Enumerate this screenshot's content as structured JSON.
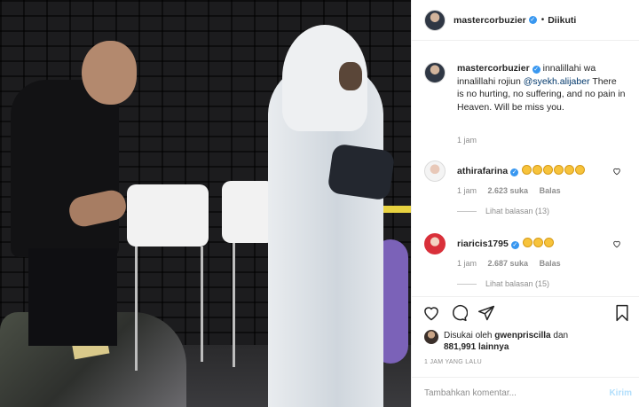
{
  "post": {
    "author": "mastercorbuzier",
    "follow_status": "Diikuti",
    "dot": "•",
    "caption": {
      "username": "mastercorbuzier",
      "text_before": "innalillahi wa innalillahi rojiun",
      "mention": "@syekh.alijaber",
      "text_after": "There is no hurting, no suffering, and no pain in Heaven. Will be miss you.",
      "time": "1 jam"
    },
    "comments": [
      {
        "username": "athirafarina",
        "emoji_count": 6,
        "time": "1 jam",
        "likes": "2.623 suka",
        "reply": "Balas",
        "view_replies": "Lihat balasan (13)"
      },
      {
        "username": "riaricis1795",
        "emoji_count": 3,
        "time": "1 jam",
        "likes": "2.687 suka",
        "reply": "Balas",
        "view_replies": "Lihat balasan (15)"
      }
    ],
    "liked_by": {
      "prefix": "Disukai oleh",
      "user": "gwenpriscilla",
      "conj": "dan",
      "count": "881,991",
      "suffix": "lainnya"
    },
    "posted_ago": "1 JAM YANG LALU",
    "add_comment_placeholder": "Tambahkan komentar...",
    "post_button": "Kirim"
  },
  "icons": [
    "like-heart-icon",
    "comment-icon",
    "share-icon",
    "bookmark-icon",
    "verified-badge-icon"
  ],
  "colors": {
    "verified": "#3897f0",
    "link": "#00376b",
    "muted": "#8e8e8e",
    "post_button_disabled": "#b2dffc"
  }
}
